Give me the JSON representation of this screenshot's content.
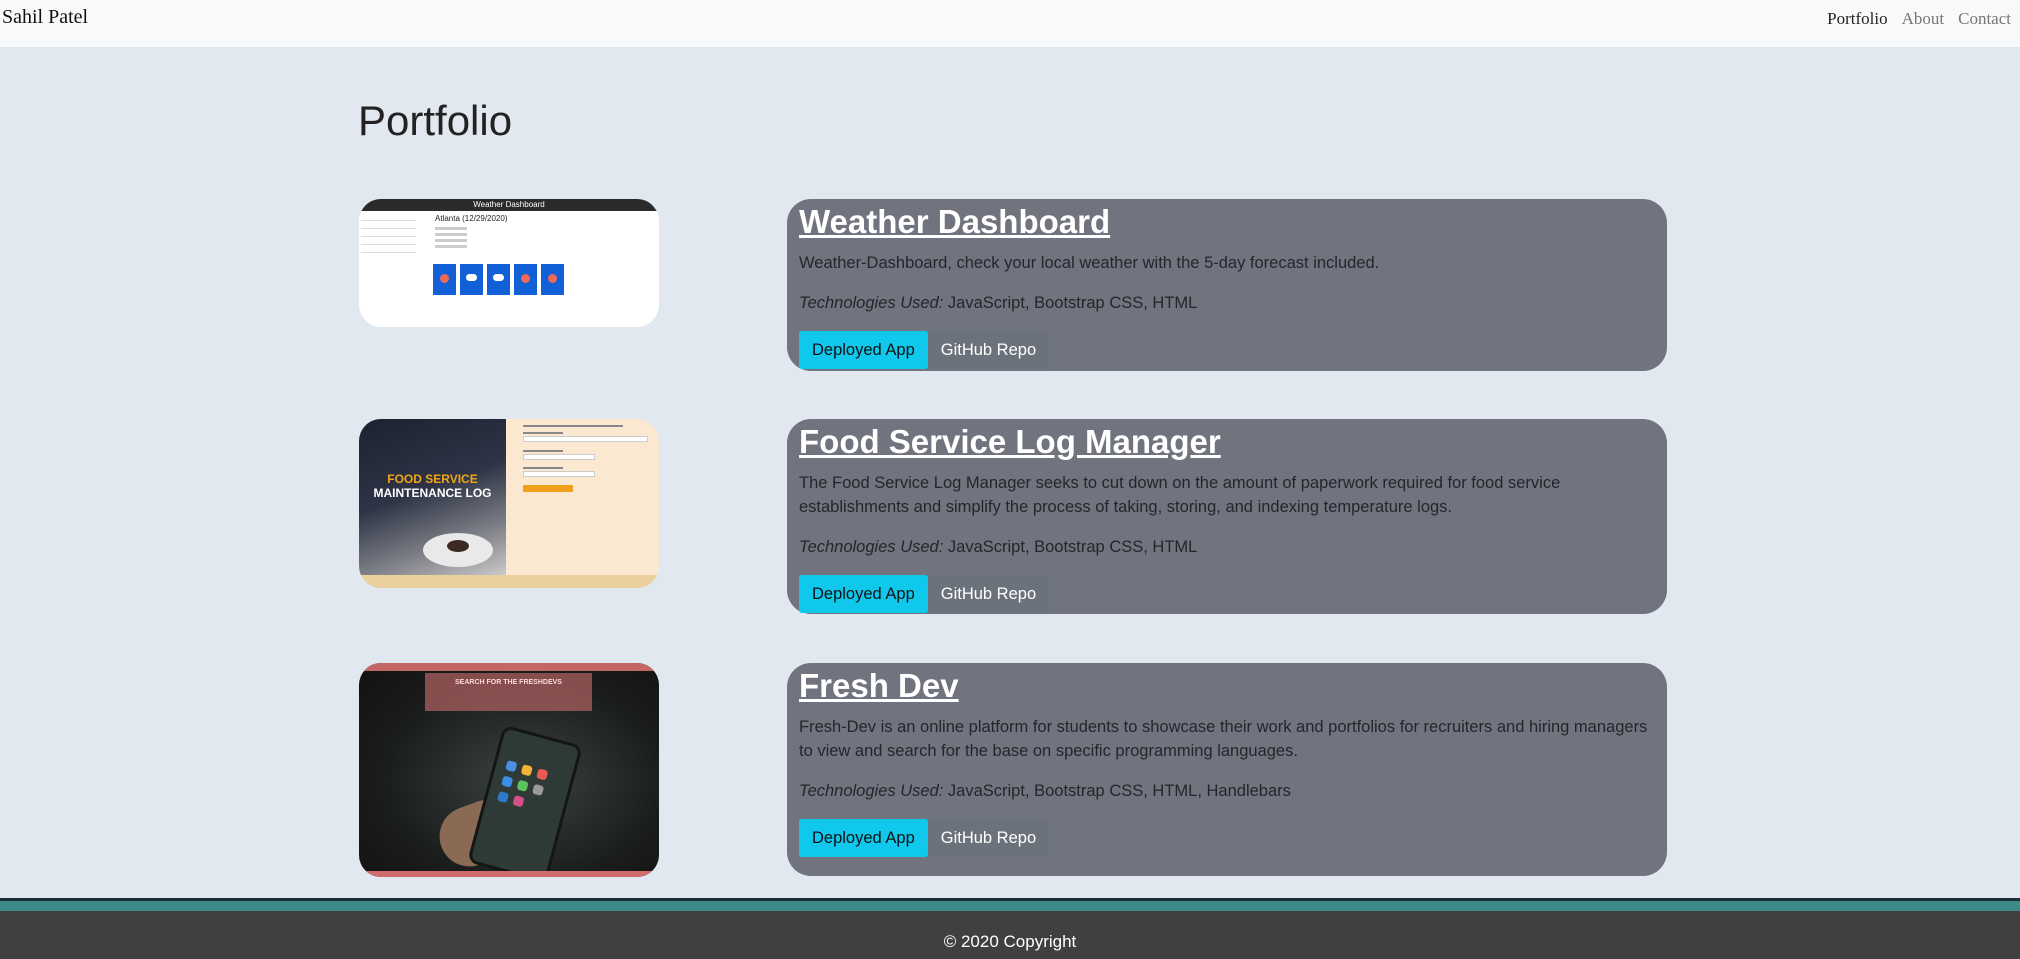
{
  "navbar": {
    "brand": "Sahil Patel",
    "links": [
      "Portfolio",
      "About",
      "Contact"
    ]
  },
  "page": {
    "title": "Portfolio"
  },
  "projects": [
    {
      "title": "Weather Dashboard",
      "description": "Weather-Dashboard, check your local weather with the 5-day forecast included.",
      "tech_label": "Technologies Used:",
      "tech_list": " JavaScript, Bootstrap CSS, HTML",
      "deploy_label": "Deployed App",
      "repo_label": "GitHub Repo",
      "thumbnail": {
        "header": "Weather Dashboard",
        "city_heading": "Atlanta (12/29/2020)"
      }
    },
    {
      "title": "Food Service Log Manager",
      "description": "The Food Service Log Manager seeks to cut down on the amount of paperwork required for food service establishments and simplify the process of taking, storing, and indexing temperature logs.",
      "tech_label": "Technologies Used:",
      "tech_list": " JavaScript, Bootstrap CSS, HTML",
      "deploy_label": "Deployed App",
      "repo_label": "GitHub Repo",
      "thumbnail": {
        "line1": "FOOD SERVICE",
        "line2": "MAINTENANCE LOG"
      }
    },
    {
      "title": "Fresh Dev",
      "description": "Fresh-Dev is an online platform for students to showcase their work and portfolios for recruiters and hiring managers to view and search for the base on specific programming languages.",
      "tech_label": "Technologies Used:",
      "tech_list": " JavaScript, Bootstrap CSS, HTML, Handlebars",
      "deploy_label": "Deployed App",
      "repo_label": "GitHub Repo",
      "thumbnail": {
        "banner": "SEARCH FOR THE FRESHDEVS"
      }
    }
  ],
  "footer": {
    "copyright": "© 2020 Copyright"
  },
  "colors": {
    "background": "#e1e8f0",
    "card": "#71747f",
    "primary_button": "#10c8ec",
    "secondary_button": "#6c727c",
    "footer": "#404040",
    "footer_accent": "#3c8a89"
  }
}
